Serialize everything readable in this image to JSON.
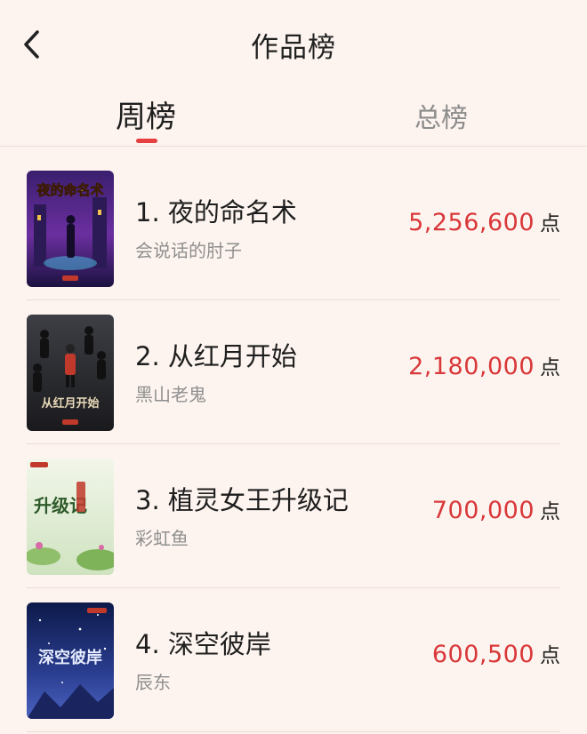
{
  "header": {
    "title": "作品榜"
  },
  "tabs": [
    {
      "label": "周榜",
      "active": true
    },
    {
      "label": "总榜",
      "active": false
    }
  ],
  "colors": {
    "accent": "#e53f3f",
    "score": "#d9383a",
    "background": "#fdf4ef"
  },
  "books": [
    {
      "title": "1. 夜的命名术",
      "author": "会说话的肘子",
      "score": "5,256,600",
      "unit": "点",
      "cover_text": "夜的命名术"
    },
    {
      "title": "2. 从红月开始",
      "author": "黑山老鬼",
      "score": "2,180,000",
      "unit": "点",
      "cover_text": "从红月开始"
    },
    {
      "title": "3. 植灵女王升级记",
      "author": "彩虹鱼",
      "score": "700,000",
      "unit": "点",
      "cover_text": "升级记"
    },
    {
      "title": "4. 深空彼岸",
      "author": "辰东",
      "score": "600,500",
      "unit": "点",
      "cover_text": "深空彼岸"
    }
  ]
}
